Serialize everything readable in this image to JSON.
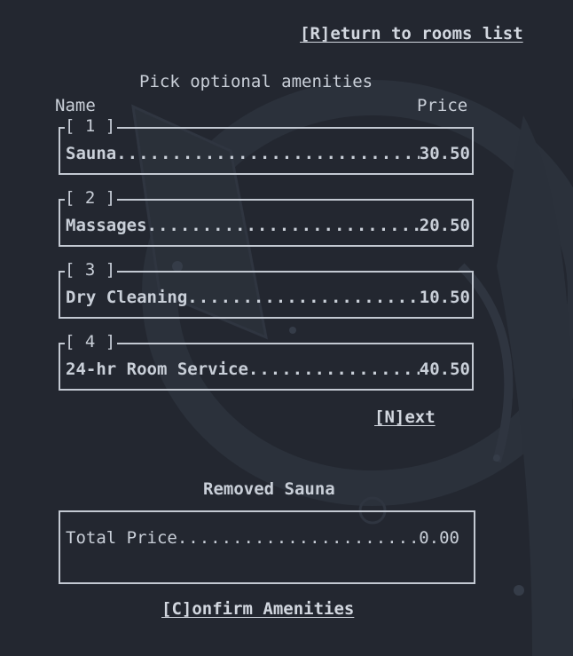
{
  "nav": {
    "return_label": "[R]eturn to rooms list"
  },
  "heading": "Pick optional amenities",
  "columns": {
    "name": "Name",
    "price": "Price"
  },
  "amenities": [
    {
      "index_label": "[ 1 ]",
      "name": "Sauna",
      "price": "30.50"
    },
    {
      "index_label": "[ 2 ]",
      "name": "Massages",
      "price": "20.50"
    },
    {
      "index_label": "[ 3 ]",
      "name": "Dry Cleaning",
      "price": "10.50"
    },
    {
      "index_label": "[ 4 ]",
      "name": "24-hr Room Service",
      "price": "40.50"
    }
  ],
  "pagination": {
    "next_label": "[N]ext"
  },
  "status_message": "Removed Sauna",
  "total": {
    "label": "Total Price",
    "value": "0.00"
  },
  "confirm_label": "[C]onfirm Amenities",
  "colors": {
    "background": "#232730",
    "text": "#c9cfd8",
    "border": "#c3c9d2"
  }
}
